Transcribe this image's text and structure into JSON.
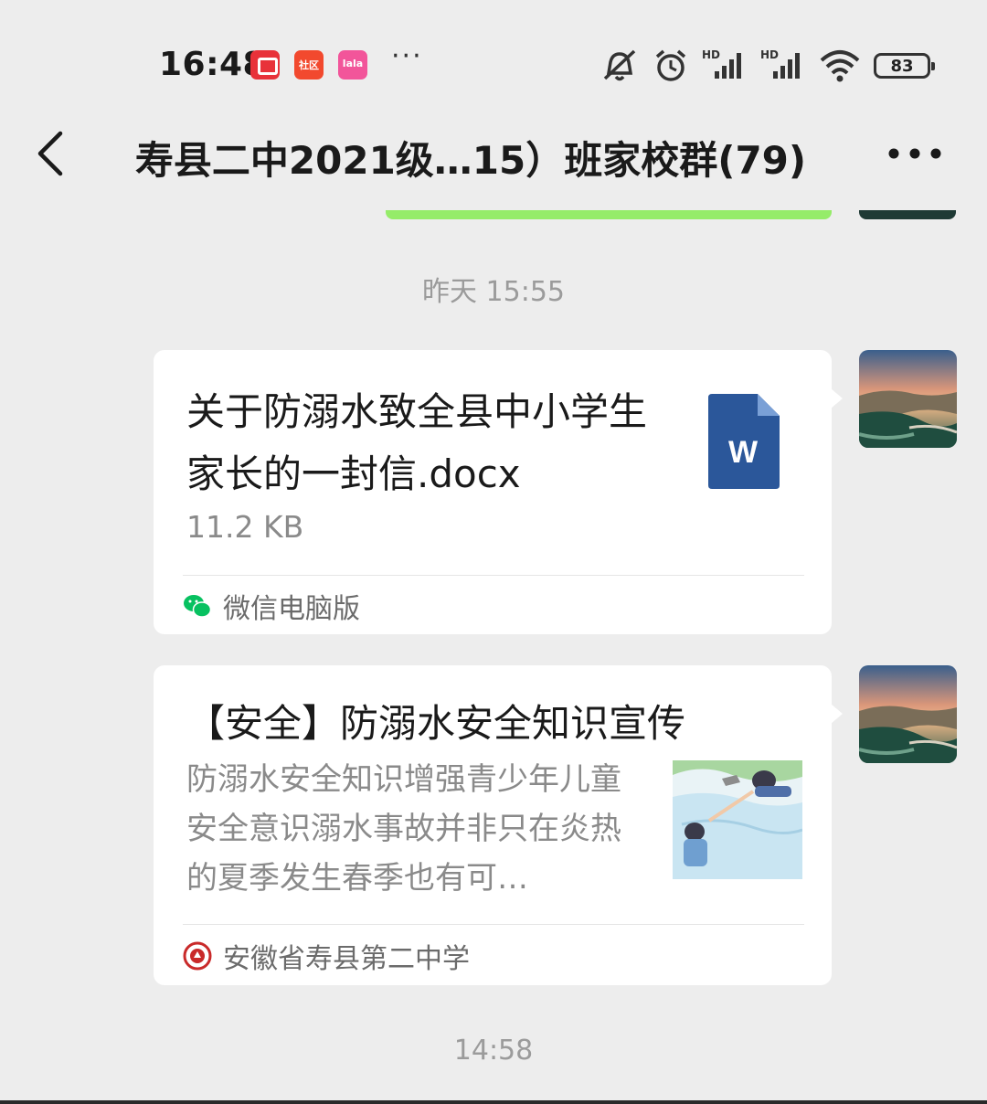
{
  "status_bar": {
    "time": "16:48",
    "app_badges": [
      "red-bag-app-icon",
      "community-app-icon",
      "lala-app-icon"
    ],
    "badge_2_text": "社区",
    "badge_3_text": "lala",
    "more": "···",
    "network_1": "HD",
    "network_2": "HD",
    "battery": "83"
  },
  "nav": {
    "back_icon": "chevron-left-icon",
    "title": "寿县二中2021级…15）班家校群(79)",
    "more_icon": "more-dots-icon"
  },
  "chat": {
    "timestamp_1": "昨天 15:55",
    "messages": [
      {
        "type": "file",
        "title": "关于防溺水致全县中小学生家长的一封信.docx",
        "size": "11.2 KB",
        "file_icon": "word-doc-icon",
        "file_icon_letter": "W",
        "source": "微信电脑版",
        "source_icon": "wechat-icon"
      },
      {
        "type": "article",
        "title": "【安全】防溺水安全知识宣传",
        "description": "防溺水安全知识增强青少年儿童安全意识溺水事故并非只在炎热的夏季发生春季也有可…",
        "thumbnail": "drowning-rescue-illustration",
        "source": "安徽省寿县第二中学",
        "source_icon": "school-logo-icon"
      }
    ],
    "timestamp_2": "14:58"
  },
  "colors": {
    "background": "#ededed",
    "bubble": "#ffffff",
    "self_bubble": "#95ec69",
    "word_blue": "#2b579a",
    "wechat_green": "#07c160"
  }
}
